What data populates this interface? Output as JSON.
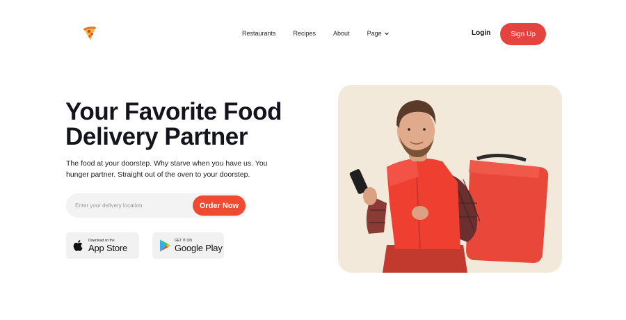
{
  "header": {
    "logo_icon": "pizza-slice-icon",
    "nav": [
      {
        "label": "Restaurants"
      },
      {
        "label": "Recipes"
      },
      {
        "label": "About"
      },
      {
        "label": "Page"
      }
    ],
    "login_label": "Login",
    "signup_label": "Sign Up"
  },
  "hero": {
    "title": "Your Favorite Food Delivery Partner",
    "subtitle": "The food at your doorstep. Why starve when you have us. You hunger partner. Straight out of the oven to your doorstep.",
    "search_placeholder": "Enter your delivery location",
    "order_label": "Order Now",
    "image_description": "delivery-man-with-red-backpack"
  },
  "stores": {
    "apple": {
      "small": "Download on the",
      "big": "App Store",
      "icon": "apple-icon"
    },
    "google": {
      "small": "GET IT ON",
      "big": "Google Play",
      "icon": "google-play-icon"
    }
  },
  "colors": {
    "accent": "#e5433d",
    "order_button": "#f04b30",
    "image_bg": "#f2e9da",
    "input_bg": "#f3f3f3"
  }
}
